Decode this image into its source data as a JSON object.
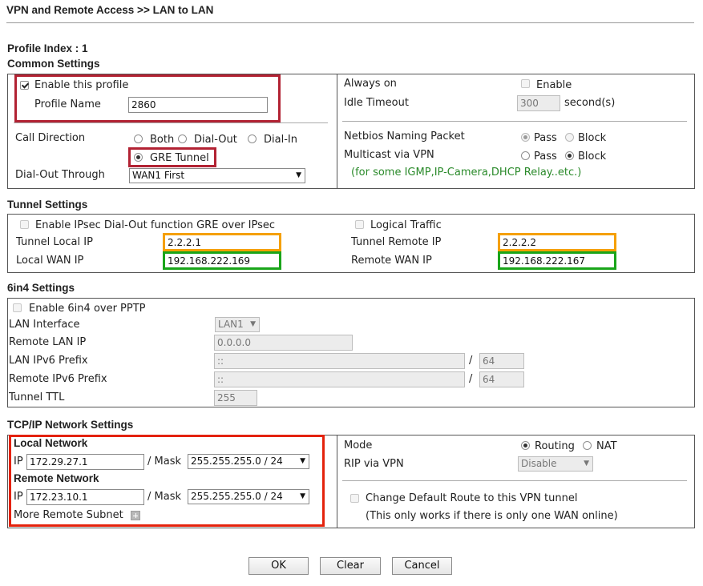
{
  "header": {
    "title": "VPN and Remote Access >> LAN to LAN"
  },
  "profile_index": "Profile Index : 1",
  "common": {
    "section_title": "Common Settings",
    "enable_label": "Enable this profile",
    "profile_name_label": "Profile Name",
    "profile_name_value": "2860",
    "call_direction_label": "Call Direction",
    "call_options": [
      "Both",
      "Dial-Out",
      "Dial-In",
      "GRE Tunnel"
    ],
    "dial_out_through_label": "Dial-Out Through",
    "dial_out_through_value": "WAN1 First",
    "always_on_label": "Always on",
    "always_on_enable_label": "Enable",
    "idle_timeout_label": "Idle Timeout",
    "idle_timeout_value": "300",
    "idle_timeout_unit": "second(s)",
    "netbios_label": "Netbios Naming Packet",
    "netbios_options": [
      "Pass",
      "Block"
    ],
    "multicast_label": "Multicast via VPN",
    "multicast_options": [
      "Pass",
      "Block"
    ],
    "multicast_note": "(for some IGMP,IP-Camera,DHCP Relay..etc.)"
  },
  "tunnel": {
    "section_title": "Tunnel Settings",
    "ipsec_label": "Enable IPsec Dial-Out function GRE over IPsec",
    "logical_label": "Logical Traffic",
    "local_ip_label": "Tunnel Local IP",
    "local_ip_value": "2.2.2.1",
    "remote_ip_label": "Tunnel Remote IP",
    "remote_ip_value": "2.2.2.2",
    "local_wan_label": "Local WAN IP",
    "local_wan_value": "192.168.222.169",
    "remote_wan_label": "Remote WAN IP",
    "remote_wan_value": "192.168.222.167"
  },
  "sixin4": {
    "section_title": "6in4 Settings",
    "enable_label": "Enable 6in4 over PPTP",
    "lan_interface_label": "LAN Interface",
    "lan_interface_value": "LAN1",
    "remote_lan_ip_label": "Remote LAN IP",
    "remote_lan_ip_value": "0.0.0.0",
    "lan_prefix_label": "LAN IPv6 Prefix",
    "lan_prefix_value": "::",
    "lan_prefix_len": "64",
    "remote_prefix_label": "Remote IPv6 Prefix",
    "remote_prefix_value": "::",
    "remote_prefix_len": "64",
    "slash": "/",
    "ttl_label": "Tunnel TTL",
    "ttl_value": "255"
  },
  "tcpip": {
    "section_title": "TCP/IP Network Settings",
    "local_network_label": "Local Network",
    "ip_label": "IP",
    "local_ip_value": "172.29.27.1",
    "mask_label": "/ Mask",
    "local_mask_value": "255.255.255.0 / 24",
    "remote_network_label": "Remote Network",
    "remote_ip_value": "172.23.10.1",
    "remote_mask_value": "255.255.255.0 / 24",
    "more_subnet_label": "More Remote Subnet",
    "mode_label": "Mode",
    "mode_options": [
      "Routing",
      "NAT"
    ],
    "rip_label": "RIP via VPN",
    "rip_value": "Disable",
    "default_route_label": "Change Default Route to this VPN tunnel",
    "default_route_note": "(This only works if there is only one WAN online)"
  },
  "buttons": {
    "ok": "OK",
    "clear": "Clear",
    "cancel": "Cancel"
  },
  "colors": {
    "red": "#b22233",
    "orange": "#f5a000",
    "green": "#1aa51a",
    "bright_red": "#e4220c"
  }
}
